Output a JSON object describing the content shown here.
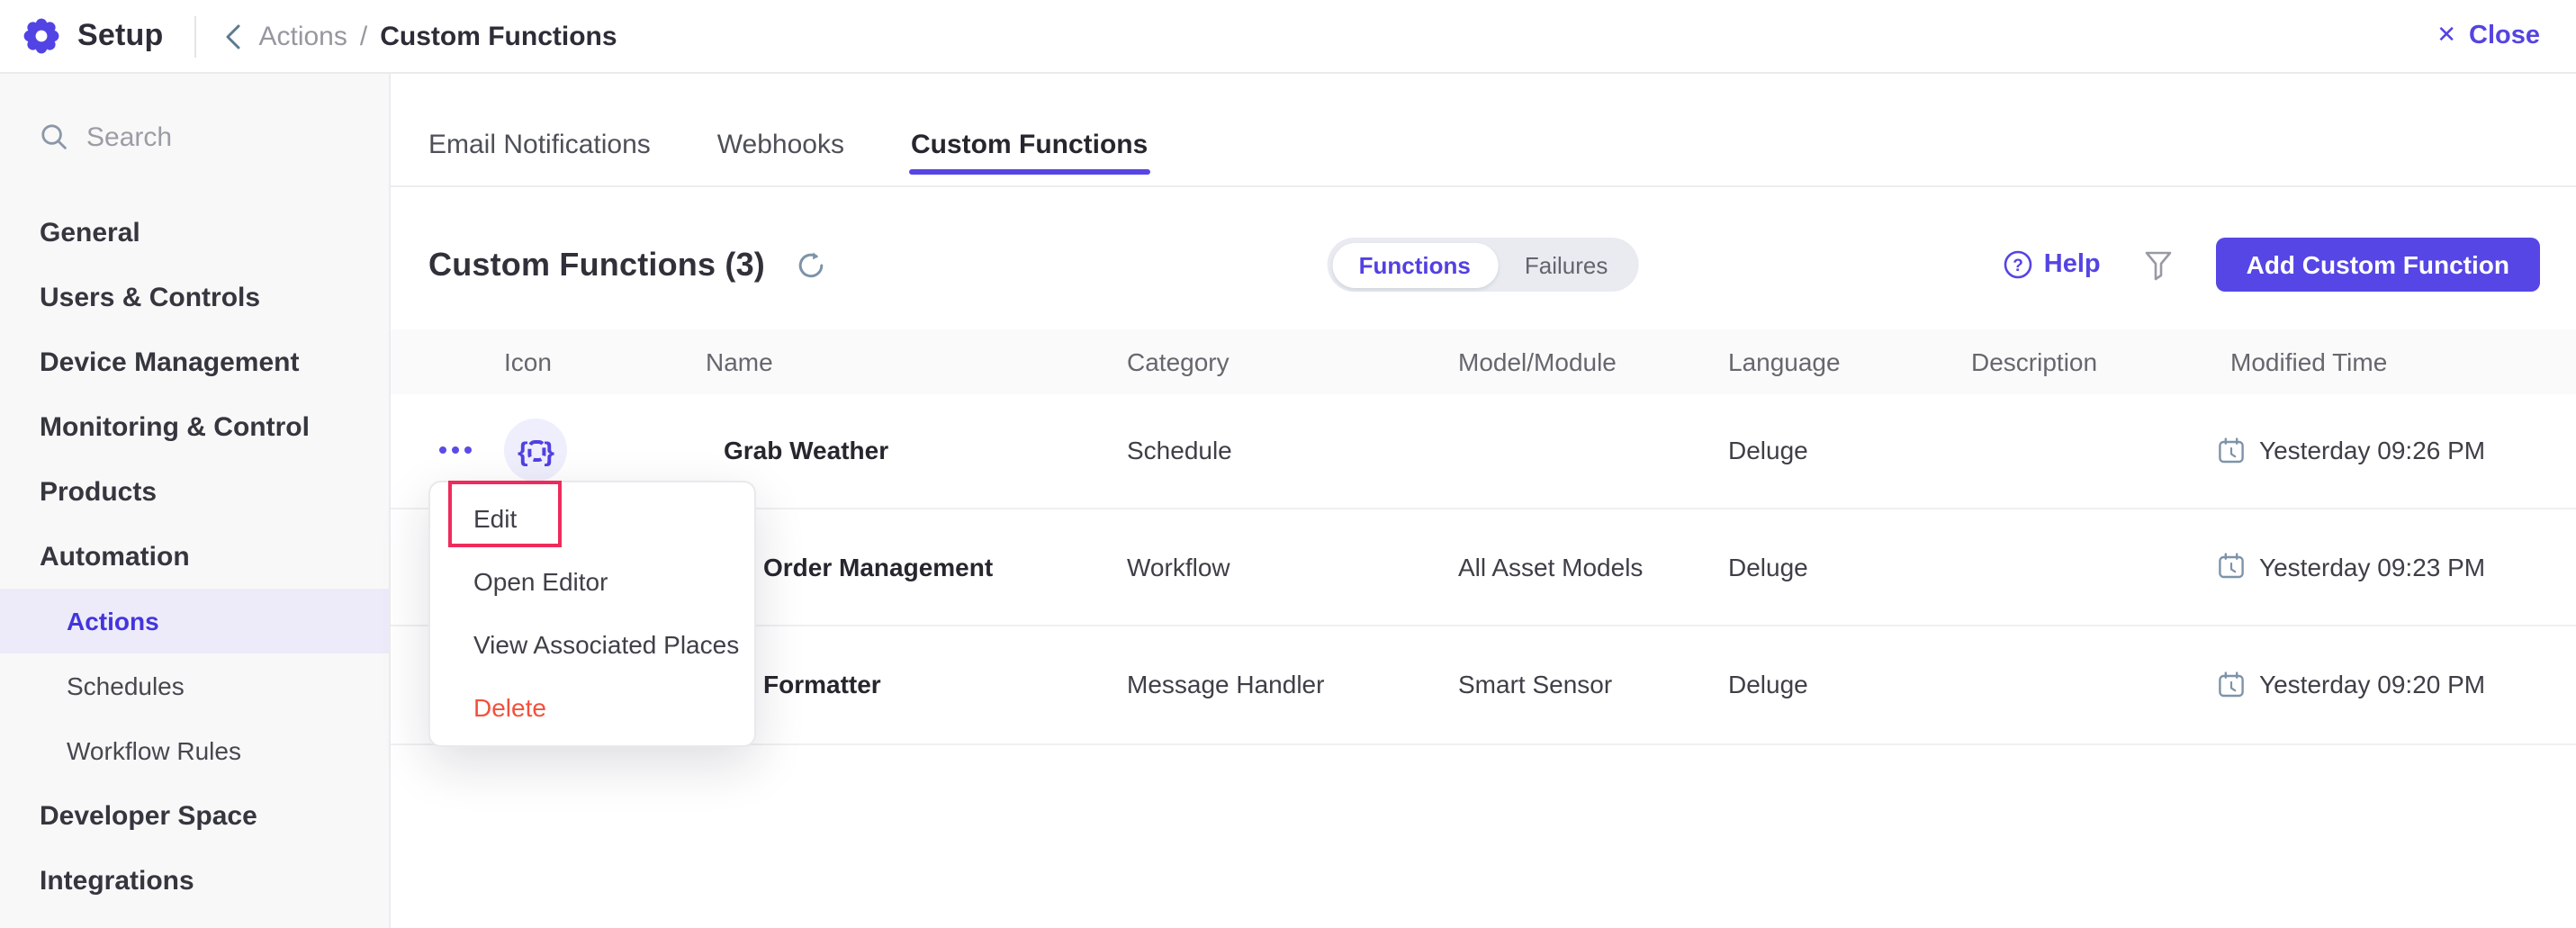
{
  "header": {
    "title": "Setup",
    "breadcrumb_parent": "Actions",
    "breadcrumb_separator": "/",
    "breadcrumb_current": "Custom Functions",
    "close_glyph": "✕",
    "close_label": "Close"
  },
  "sidebar": {
    "search_placeholder": "Search",
    "items": [
      {
        "label": "General",
        "type": "section",
        "active": false
      },
      {
        "label": "Users & Controls",
        "type": "section",
        "active": false
      },
      {
        "label": "Device Management",
        "type": "section",
        "active": false
      },
      {
        "label": "Monitoring & Control",
        "type": "section",
        "active": false
      },
      {
        "label": "Products",
        "type": "section",
        "active": false
      },
      {
        "label": "Automation",
        "type": "section",
        "active": false
      },
      {
        "label": "Actions",
        "type": "sub",
        "active": true
      },
      {
        "label": "Schedules",
        "type": "sub",
        "active": false
      },
      {
        "label": "Workflow Rules",
        "type": "sub",
        "active": false
      },
      {
        "label": "Developer Space",
        "type": "section",
        "active": false
      },
      {
        "label": "Integrations",
        "type": "section",
        "active": false
      }
    ]
  },
  "tabs": {
    "items": [
      {
        "label": "Email Notifications",
        "active": false
      },
      {
        "label": "Webhooks",
        "active": false
      },
      {
        "label": "Custom Functions",
        "active": true
      }
    ]
  },
  "toolbar": {
    "title": "Custom Functions (3)",
    "toggle": {
      "functions_label": "Functions",
      "failures_label": "Failures",
      "selected": "Functions"
    },
    "help_label": "Help",
    "add_button_label": "Add Custom Function"
  },
  "table": {
    "columns": [
      "Icon",
      "Name",
      "Category",
      "Model/Module",
      "Language",
      "Description",
      "Modified Time"
    ],
    "rows": [
      {
        "name": "Grab Weather",
        "category": "Schedule",
        "model_module": "",
        "language": "Deluge",
        "description": "",
        "modified_time": "Yesterday 09:26 PM"
      },
      {
        "name": "Order Management",
        "category": "Workflow",
        "model_module": "All Asset Models",
        "language": "Deluge",
        "description": "",
        "modified_time": "Yesterday 09:23 PM"
      },
      {
        "name": "Formatter",
        "category": "Message Handler",
        "model_module": "Smart Sensor",
        "language": "Deluge",
        "description": "",
        "modified_time": "Yesterday 09:20 PM"
      }
    ]
  },
  "context_menu": {
    "items": [
      {
        "label": "Edit",
        "danger": false,
        "annotated": true
      },
      {
        "label": "Open Editor",
        "danger": false,
        "annotated": false
      },
      {
        "label": "View Associated Places",
        "danger": false,
        "annotated": false
      },
      {
        "label": "Delete",
        "danger": true,
        "annotated": false
      }
    ]
  },
  "colors": {
    "accent": "#5646e5",
    "accent_text": "#4335dc",
    "danger": "#f4503c",
    "annotation": "#ee2b5c",
    "sidebar_bg": "#f8f8f9",
    "active_item_bg": "#edebfa",
    "table_header_bg": "#fafafa"
  }
}
